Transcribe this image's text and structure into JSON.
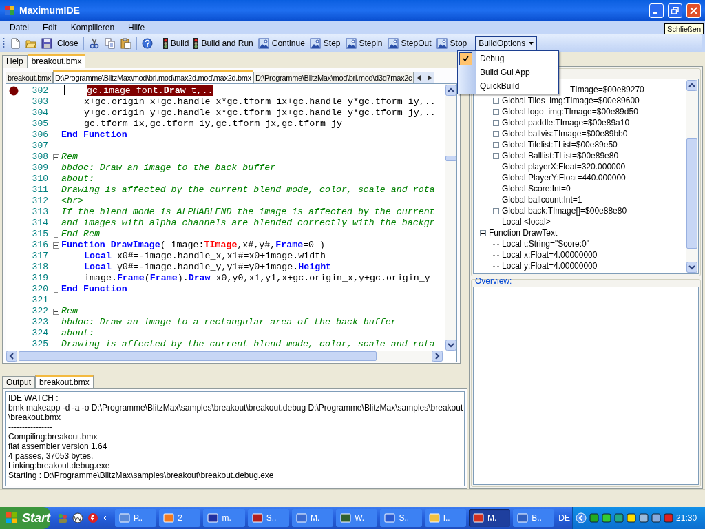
{
  "window": {
    "title": "MaximumIDE",
    "tooltip": "Schließen"
  },
  "menu": [
    "Datei",
    "Edit",
    "Kompilieren",
    "Hilfe"
  ],
  "toolbar": {
    "buttons": [
      "Close",
      "Build",
      "Build and Run",
      "Continue",
      "Step",
      "Stepin",
      "StepOut",
      "Stop"
    ],
    "build_options": {
      "label": "BuildOptions",
      "open": true,
      "items": [
        {
          "label": "Debug",
          "checked": true
        },
        {
          "label": "Build Gui App",
          "checked": false
        },
        {
          "label": "QuickBuild",
          "checked": false
        }
      ]
    }
  },
  "doc_tabs": [
    {
      "label": "Help",
      "selected": false
    },
    {
      "label": "breakout.bmx",
      "selected": true
    }
  ],
  "file_tabs": [
    {
      "label": "breakout.bmx",
      "selected": false
    },
    {
      "label": "D:\\Programme\\BlitzMax\\mod\\brl.mod\\max2d.mod\\max2d.bmx",
      "selected": true
    },
    {
      "label": "D:\\Programme\\BlitzMax\\mod\\brl.mod\\d3d7max2c",
      "selected": false
    }
  ],
  "editor": {
    "lines": [
      {
        "number": "302",
        "breakpoint": true,
        "indented": true,
        "segments": [
          {
            "text": "gc.image_font.",
            "kind": "highlight"
          },
          {
            "text": "Draw",
            "kind": "highlight_keyword"
          },
          {
            "text": " t,..",
            "kind": "highlight"
          }
        ]
      },
      {
        "number": "303",
        "breakpoint": false,
        "indented": true,
        "segments": [
          {
            "text": "x+gc.origin_x+gc.handle_x*gc.tform_ix+gc.handle_y*gc.tform_iy,..",
            "kind": "plain"
          }
        ]
      },
      {
        "number": "304",
        "breakpoint": false,
        "indented": true,
        "segments": [
          {
            "text": "y+gc.origin_y+gc.handle_x*gc.tform_jx+gc.handle_y*gc.tform_jy,..",
            "kind": "plain"
          }
        ]
      },
      {
        "number": "305",
        "breakpoint": false,
        "indented": true,
        "segments": [
          {
            "text": "gc.tform_ix,gc.tform_iy,gc.tform_jx,gc.tform_jy",
            "kind": "plain"
          }
        ]
      },
      {
        "number": "306",
        "breakpoint": false,
        "indented": false,
        "kind": "blockend",
        "segments": [
          {
            "text": "End Function",
            "kind": "keyword"
          }
        ]
      },
      {
        "number": "307",
        "breakpoint": false,
        "kind": "line"
      },
      {
        "number": "308",
        "breakpoint": false,
        "indented": false,
        "kind": "block",
        "segments": [
          {
            "text": "Rem",
            "kind": "comment"
          }
        ]
      },
      {
        "number": "309",
        "breakpoint": false,
        "indented": false,
        "segments": [
          {
            "text": "bbdoc: Draw an image to the back buffer",
            "kind": "comment"
          }
        ]
      },
      {
        "number": "310",
        "breakpoint": false,
        "indented": false,
        "segments": [
          {
            "text": "about:",
            "kind": "comment"
          }
        ]
      },
      {
        "number": "311",
        "breakpoint": false,
        "indented": false,
        "segments": [
          {
            "text": "Drawing is affected by the current blend mode, color, scale and rota",
            "kind": "comment"
          }
        ]
      },
      {
        "number": "312",
        "breakpoint": false,
        "indented": false,
        "segments": [
          {
            "text": "<br>",
            "kind": "comment"
          }
        ]
      },
      {
        "number": "313",
        "breakpoint": false,
        "indented": false,
        "segments": [
          {
            "text": "If the blend mode is ALPHABLEND the image is affected by the current",
            "kind": "comment"
          }
        ]
      },
      {
        "number": "314",
        "breakpoint": false,
        "indented": false,
        "segments": [
          {
            "text": "and images with alpha channels are blended correctly with the backgr",
            "kind": "comment"
          }
        ]
      },
      {
        "number": "315",
        "breakpoint": false,
        "indented": false,
        "kind": "blockend",
        "segments": [
          {
            "text": "End Rem",
            "kind": "comment"
          }
        ]
      },
      {
        "number": "316",
        "breakpoint": false,
        "indented": false,
        "kind": "block",
        "segments": [
          {
            "text": "Function DrawImage",
            "kind": "keyword"
          },
          {
            "text": "( image:",
            "kind": "plain"
          },
          {
            "text": "TImage",
            "kind": "type"
          },
          {
            "text": ",x#,y#,",
            "kind": "plain"
          },
          {
            "text": "Frame",
            "kind": "keyword"
          },
          {
            "text": "=0 )",
            "kind": "plain"
          }
        ]
      },
      {
        "number": "317",
        "breakpoint": false,
        "indented": true,
        "segments": [
          {
            "text": "Local",
            "kind": "keyword"
          },
          {
            "text": " x0#=-image.handle_x,x1#=x0+image.width",
            "kind": "plain"
          }
        ]
      },
      {
        "number": "318",
        "breakpoint": false,
        "indented": true,
        "segments": [
          {
            "text": "Local",
            "kind": "keyword"
          },
          {
            "text": " y0#=-image.handle_y,y1#=y0+image.",
            "kind": "plain"
          },
          {
            "text": "Height",
            "kind": "keyword"
          }
        ]
      },
      {
        "number": "319",
        "breakpoint": false,
        "indented": true,
        "segments": [
          {
            "text": "image.",
            "kind": "plain"
          },
          {
            "text": "Frame",
            "kind": "keyword"
          },
          {
            "text": "(",
            "kind": "plain"
          },
          {
            "text": "Frame",
            "kind": "keyword"
          },
          {
            "text": ").",
            "kind": "plain"
          },
          {
            "text": "Draw",
            "kind": "keyword"
          },
          {
            "text": " x0,y0,x1,y1,x+gc.origin_x,y+gc.origin_y",
            "kind": "plain"
          }
        ]
      },
      {
        "number": "320",
        "breakpoint": false,
        "indented": false,
        "kind": "blockend",
        "segments": [
          {
            "text": "End Function",
            "kind": "keyword"
          }
        ]
      },
      {
        "number": "321",
        "breakpoint": false,
        "kind": "line"
      },
      {
        "number": "322",
        "breakpoint": false,
        "indented": false,
        "kind": "block",
        "segments": [
          {
            "text": "Rem",
            "kind": "comment"
          }
        ]
      },
      {
        "number": "323",
        "breakpoint": false,
        "indented": false,
        "segments": [
          {
            "text": "bbdoc: Draw an image to a rectangular area of the back buffer",
            "kind": "comment"
          }
        ]
      },
      {
        "number": "324",
        "breakpoint": false,
        "indented": false,
        "segments": [
          {
            "text": "about:",
            "kind": "comment"
          }
        ]
      },
      {
        "number": "325",
        "breakpoint": false,
        "indented": false,
        "segments": [
          {
            "text": "Drawing is affected by the current blend mode, color, scale and rota",
            "kind": "comment"
          }
        ]
      }
    ]
  },
  "debug_tree": {
    "globals": [
      {
        "label": "TImage=$00e89270",
        "expandable": false,
        "partial": true
      },
      {
        "label": "Global Tiles_img:TImage=$00e89600",
        "expandable": true
      },
      {
        "label": "Global logo_img:TImage=$00e89d50",
        "expandable": true
      },
      {
        "label": "Global paddle:TImage=$00e89a10",
        "expandable": true
      },
      {
        "label": "Global ballvis:TImage=$00e89bb0",
        "expandable": true
      },
      {
        "label": "Global Tilelist:TList=$00e89e50",
        "expandable": true
      },
      {
        "label": "Global Balllist:TList=$00e89e80",
        "expandable": true
      },
      {
        "label": "Global playerX:Float=320.000000",
        "expandable": false
      },
      {
        "label": "Global PlayerY:Float=440.000000",
        "expandable": false
      },
      {
        "label": "Global Score:Int=0",
        "expandable": false
      },
      {
        "label": "Global ballcount:Int=1",
        "expandable": false
      },
      {
        "label": "Global back:TImage[]=$00e88e80",
        "expandable": true
      },
      {
        "label": "Local <local>",
        "expandable": false
      }
    ],
    "items": [
      {
        "label": "Function DrawText",
        "expanded": true,
        "children": [
          {
            "label": "Local t:String=\"Score:0\""
          },
          {
            "label": "Local x:Float=4.00000000"
          },
          {
            "label": "Local y:Float=4.00000000"
          }
        ]
      }
    ]
  },
  "overview": {
    "label": "Overview:"
  },
  "output_tabs": [
    {
      "label": "Output",
      "selected": false
    },
    {
      "label": "breakout.bmx",
      "selected": true
    }
  ],
  "output_lines": [
    "IDE WATCH :",
    "bmk makeapp -d  -a  -o D:\\Programme\\BlitzMax\\samples\\breakout\\breakout.debug D:\\Programme\\BlitzMax\\samples\\breakout",
    "\\breakout.bmx",
    "----------------",
    "Compiling:breakout.bmx",
    "flat assembler  version 1.64",
    "4 passes, 37053 bytes.",
    "Linking:breakout.debug.exe",
    "Starting : D:\\Programme\\BlitzMax\\samples\\breakout\\breakout.debug.exe"
  ],
  "taskbar": {
    "start": "Start",
    "tasks": [
      {
        "label": "P..",
        "selected": false
      },
      {
        "label": "2",
        "selected": false
      },
      {
        "label": "m.",
        "selected": false
      },
      {
        "label": "S..",
        "selected": false
      },
      {
        "label": "M.",
        "selected": false
      },
      {
        "label": "W.",
        "selected": false
      },
      {
        "label": "S..",
        "selected": false
      },
      {
        "label": "I..",
        "selected": false
      },
      {
        "label": "M.",
        "selected": true
      },
      {
        "label": "B..",
        "selected": false
      }
    ],
    "language": "DE",
    "clock": "21:30"
  }
}
